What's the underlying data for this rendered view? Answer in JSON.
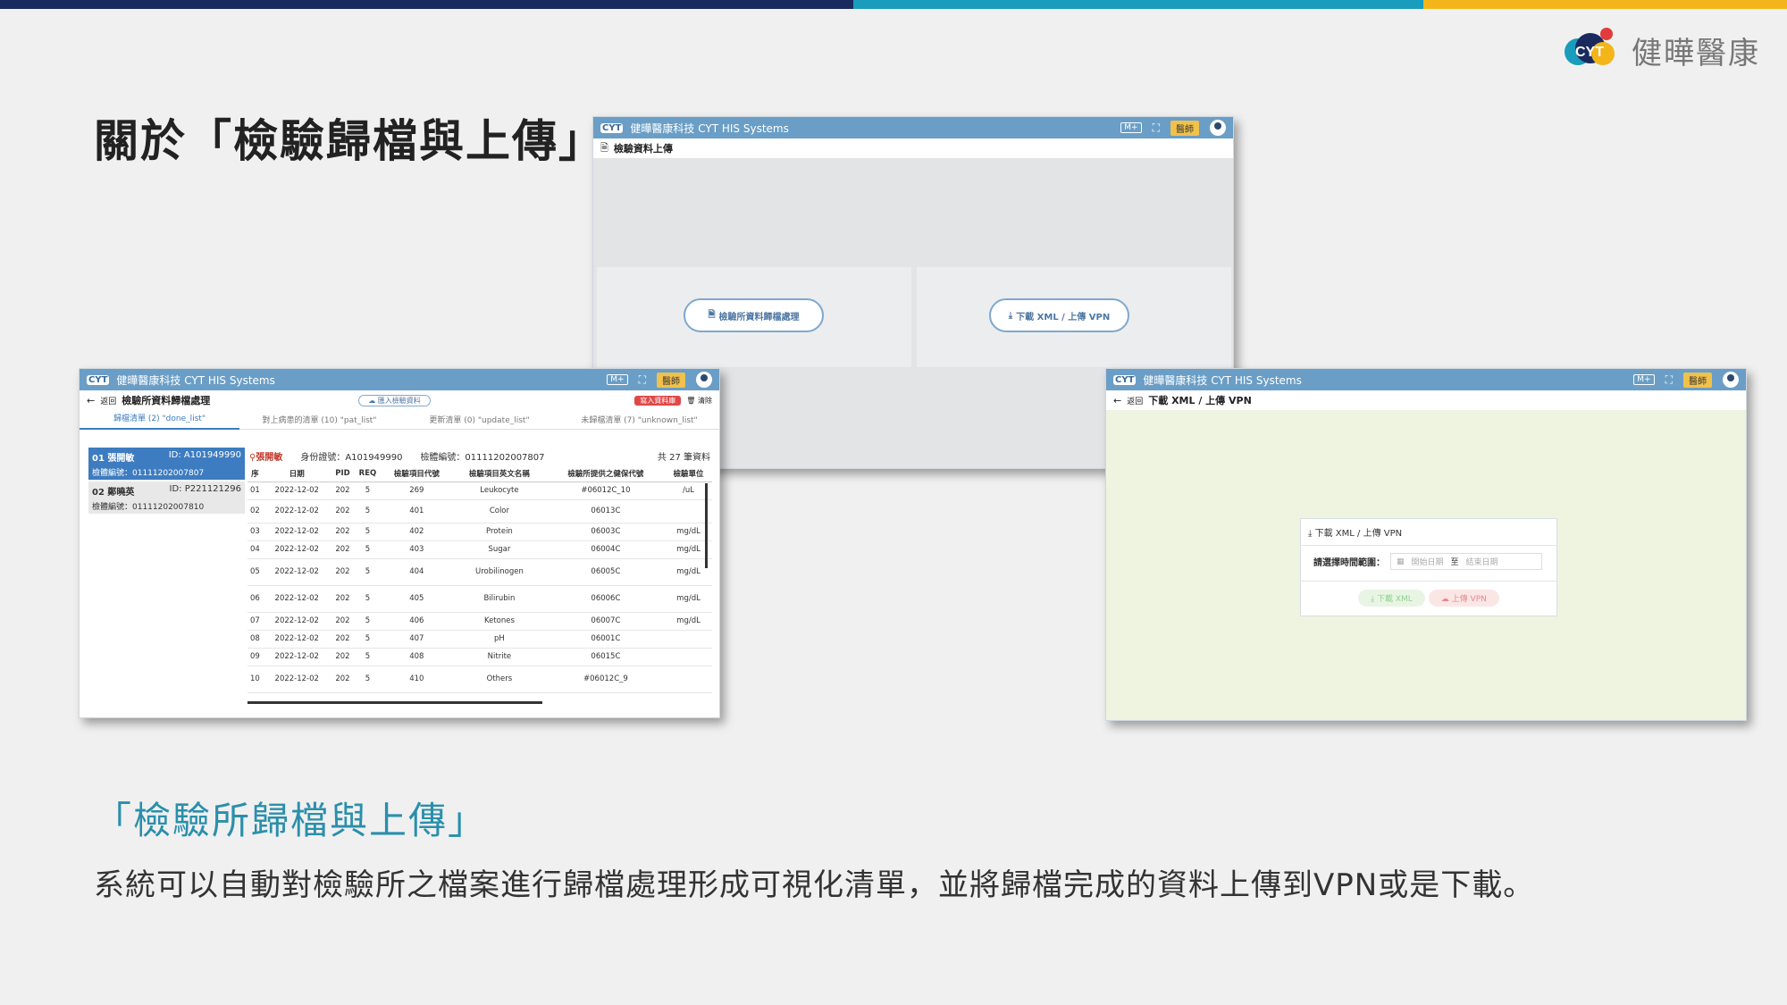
{
  "colors": {
    "navy": "#1a2a5e",
    "teal": "#1a9cbc",
    "gold": "#f3b51a",
    "accent": "#2a8fab"
  },
  "brand": {
    "logo_text": "健曄醫康"
  },
  "title": "關於「檢驗歸檔與上傳」",
  "app": {
    "name": "健曄醫康科技 CYT HIS Systems",
    "logo_label": "CYT",
    "badge": "M+",
    "user": "醫師"
  },
  "upload_window": {
    "page_title": "檢驗資料上傳",
    "btn_archive": "檢驗所資料歸檔處理",
    "btn_xml": "下載 XML / 上傳 VPN"
  },
  "archive_window": {
    "back": "返回",
    "page_title": "檢驗所資料歸檔處理",
    "import_btn": "匯入檢驗資料",
    "write_btn": "寫入資料庫",
    "clear_btn": "清除",
    "tabs": [
      "歸檔清單 (2) \"done_list\"",
      "對上病患的清單 (10) \"pat_list\"",
      "更新清單 (0) \"update_list\"",
      "未歸檔清單 (7) \"unknown_list\""
    ],
    "patients": [
      {
        "no": "01",
        "name": "張開敏",
        "id": "ID: A101949990",
        "spec": "檢體編號：01111202007807"
      },
      {
        "no": "02",
        "name": "鄭曉英",
        "id": "ID: P221121296",
        "spec": "檢體編號：01111202007810"
      }
    ],
    "info": {
      "name": "張開敏",
      "id": "身份證號：A101949990",
      "spec": "檢體編號：01111202007807",
      "total": "共 27 筆資料"
    },
    "columns": [
      "序",
      "日期",
      "PID",
      "REQ",
      "檢驗項目代號",
      "檢驗項目英文名稱",
      "檢驗所提供之健保代號",
      "檢驗單位"
    ],
    "rows": [
      [
        "01",
        "2022-12-02",
        "202",
        "5",
        "269",
        "Leukocyte",
        "#06012C_10",
        "/uL"
      ],
      [
        "02",
        "2022-12-02",
        "202",
        "5",
        "401",
        "Color",
        "06013C",
        ""
      ],
      [
        "03",
        "2022-12-02",
        "202",
        "5",
        "402",
        "Protein",
        "06003C",
        "mg/dL"
      ],
      [
        "04",
        "2022-12-02",
        "202",
        "5",
        "403",
        "Sugar",
        "06004C",
        "mg/dL"
      ],
      [
        "05",
        "2022-12-02",
        "202",
        "5",
        "404",
        "Urobilinogen",
        "06005C",
        "mg/dL"
      ],
      [
        "06",
        "2022-12-02",
        "202",
        "5",
        "405",
        "Bilirubin",
        "06006C",
        "mg/dL"
      ],
      [
        "07",
        "2022-12-02",
        "202",
        "5",
        "406",
        "Ketones",
        "06007C",
        "mg/dL"
      ],
      [
        "08",
        "2022-12-02",
        "202",
        "5",
        "407",
        "pH",
        "06001C",
        ""
      ],
      [
        "09",
        "2022-12-02",
        "202",
        "5",
        "408",
        "Nitrite",
        "06015C",
        ""
      ],
      [
        "10",
        "2022-12-02",
        "202",
        "5",
        "410",
        "Others",
        "#06012C_9",
        ""
      ]
    ]
  },
  "vpn_window": {
    "back": "返回",
    "page_title": "下載 XML / 上傳 VPN",
    "box_title": "下載 XML / 上傳 VPN",
    "range_label": "請選擇時間範圍：",
    "start_ph": "開始日期",
    "to": "至",
    "end_ph": "結束日期",
    "download_btn": "下載 XML",
    "upload_btn": "上傳 VPN"
  },
  "subtitle": "「檢驗所歸檔與上傳」",
  "description": "系統可以自動對檢驗所之檔案進行歸檔處理形成可視化清單，並將歸檔完成的資料上傳到VPN或是下載。"
}
